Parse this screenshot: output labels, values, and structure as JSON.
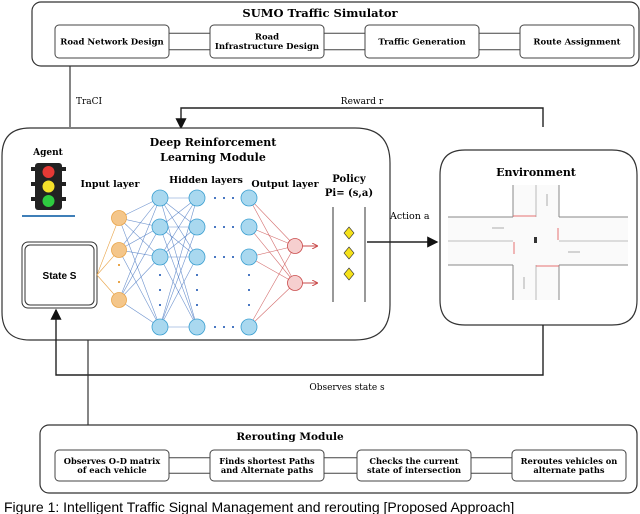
{
  "sumo": {
    "title": "SUMO Traffic Simulator",
    "boxes": [
      {
        "lines": [
          "Road Network Design"
        ]
      },
      {
        "lines": [
          "Road",
          "Infrastructure Design"
        ]
      },
      {
        "lines": [
          "Traffic Generation"
        ]
      },
      {
        "lines": [
          "Route Assignment"
        ]
      }
    ]
  },
  "connectors": {
    "traci": "TraCI",
    "reward": "Reward r",
    "action": "Action a",
    "observes": "Observes state s"
  },
  "drl": {
    "title_lines": [
      "Deep Reinforcement",
      "Learning Module"
    ],
    "agent_label": "Agent",
    "state_label": "State S",
    "input_layer": "Input layer",
    "hidden_layers": "Hidden layers",
    "output_layer": "Output layer",
    "policy_lines": [
      "Policy",
      "Pi= (s,a)"
    ],
    "colors": {
      "input": "#f4c68a",
      "hidden": "#a9d8ef",
      "output": "#f6cfcf",
      "input_edge": "#e9a54a",
      "hidden_edge": "#4a78c2",
      "output_edge": "#c94a4a"
    }
  },
  "environment": {
    "title": "Environment"
  },
  "rerouting": {
    "title": "Rerouting Module",
    "boxes": [
      {
        "lines": [
          "Observes O-D matrix",
          "of each vehicle"
        ]
      },
      {
        "lines": [
          "Finds shortest Paths",
          "and Alternate paths"
        ]
      },
      {
        "lines": [
          "Checks the current",
          "state of intersection"
        ]
      },
      {
        "lines": [
          "Reroutes vehicles on",
          "alternate paths"
        ]
      }
    ]
  },
  "caption": "Figure 1: Intelligent Traffic Signal Management and rerouting [Proposed Approach]"
}
